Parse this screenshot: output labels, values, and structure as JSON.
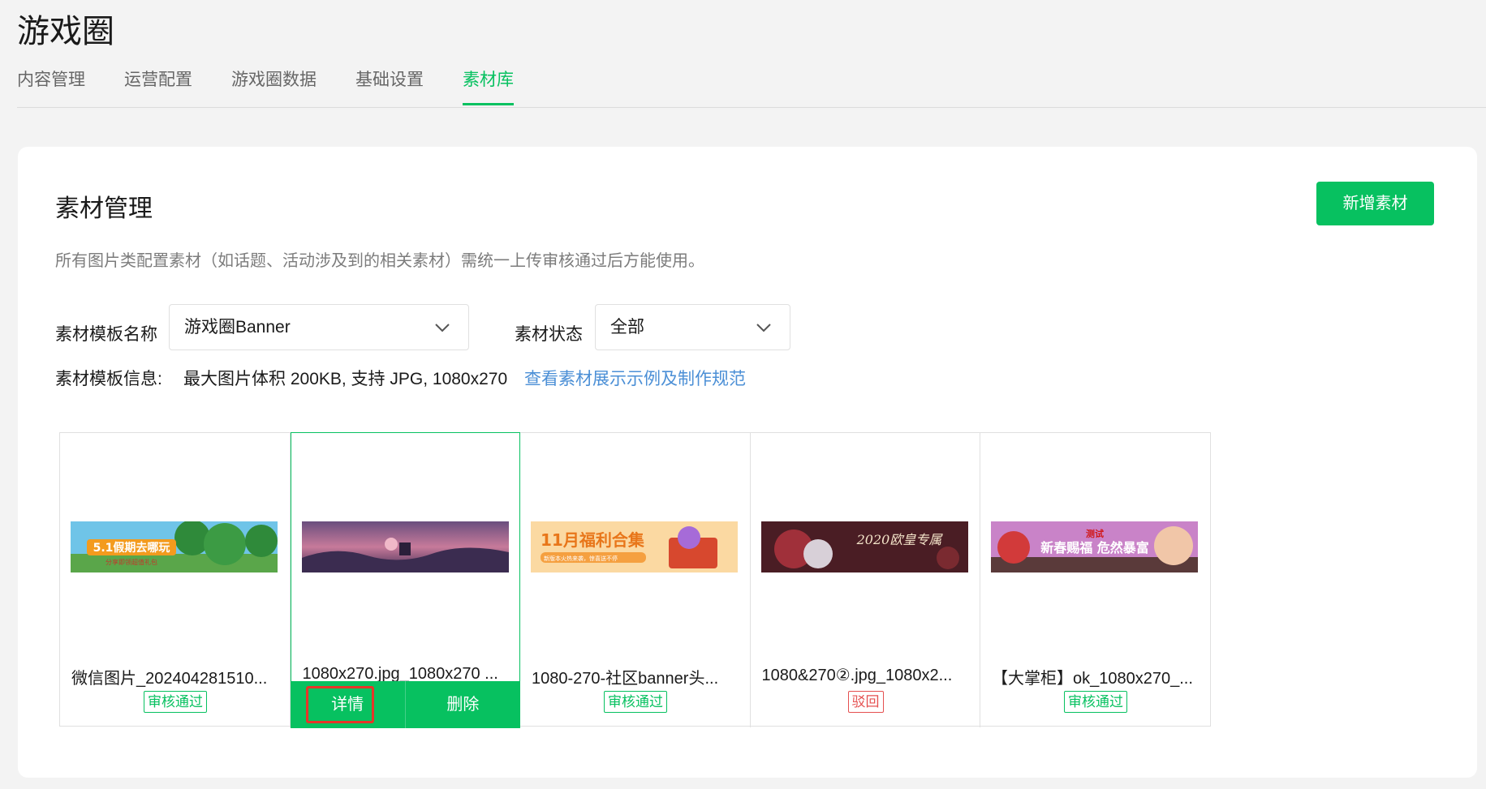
{
  "app": {
    "title": "游戏圈"
  },
  "tabs": [
    {
      "label": "内容管理",
      "active": false
    },
    {
      "label": "运营配置",
      "active": false
    },
    {
      "label": "游戏圈数据",
      "active": false
    },
    {
      "label": "基础设置",
      "active": false
    },
    {
      "label": "素材库",
      "active": true
    }
  ],
  "card": {
    "title": "素材管理",
    "add_button": "新增素材",
    "description": "所有图片类配置素材（如话题、活动涉及到的相关素材）需统一上传审核通过后方能使用。"
  },
  "filters": {
    "template_label": "素材模板名称",
    "template_value": "游戏圈Banner",
    "status_label": "素材状态",
    "status_value": "全部"
  },
  "template_info": {
    "label": "素材模板信息:",
    "value": "最大图片体积 200KB, 支持 JPG, 1080x270",
    "link": "查看素材展示示例及制作规范"
  },
  "materials": [
    {
      "name": "微信图片_202404281510...",
      "status": "审核通过",
      "status_type": "approved",
      "thumb_text": "5.1假期去哪玩",
      "thumb_sub": "分享即领超值礼包"
    },
    {
      "name": "1080x270.jpg_1080x270 ...",
      "status": "",
      "status_type": "hover",
      "detail": "详情",
      "delete": "删除"
    },
    {
      "name": "1080-270-社区banner头...",
      "status": "审核通过",
      "status_type": "approved",
      "thumb_text": "11月福利合集",
      "thumb_sub": "新版本火热来袭，惊喜送不停"
    },
    {
      "name": "1080&270②.jpg_1080x2...",
      "status": "驳回",
      "status_type": "rejected",
      "thumb_text": "2020欧皇专属"
    },
    {
      "name": "【大掌柜】ok_1080x270_...",
      "status": "审核通过",
      "status_type": "approved",
      "thumb_text": "新春赐福 危然暴富",
      "thumb_tag": "测试"
    }
  ],
  "colors": {
    "accent": "#07c160",
    "link": "#4b8fd6",
    "reject": "#e55050",
    "highlight": "#e53528"
  }
}
